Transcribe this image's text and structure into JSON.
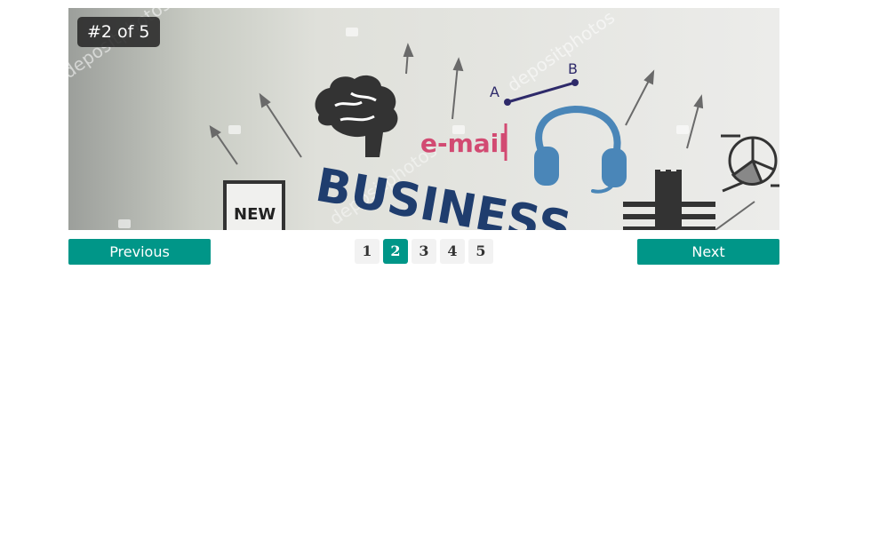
{
  "colors": {
    "accent": "#009688"
  },
  "slider": {
    "counter": "#2 of 5",
    "current": 2,
    "total": 5,
    "image_text": {
      "headline": "BUSINESS",
      "email": "e-mail",
      "new_tag": "NEW",
      "point_a": "A",
      "point_b": "B",
      "watermark": "depositphotos"
    }
  },
  "controls": {
    "prev_label": "Previous",
    "next_label": "Next"
  },
  "pagination": {
    "pages": [
      "1",
      "2",
      "3",
      "4",
      "5"
    ]
  }
}
